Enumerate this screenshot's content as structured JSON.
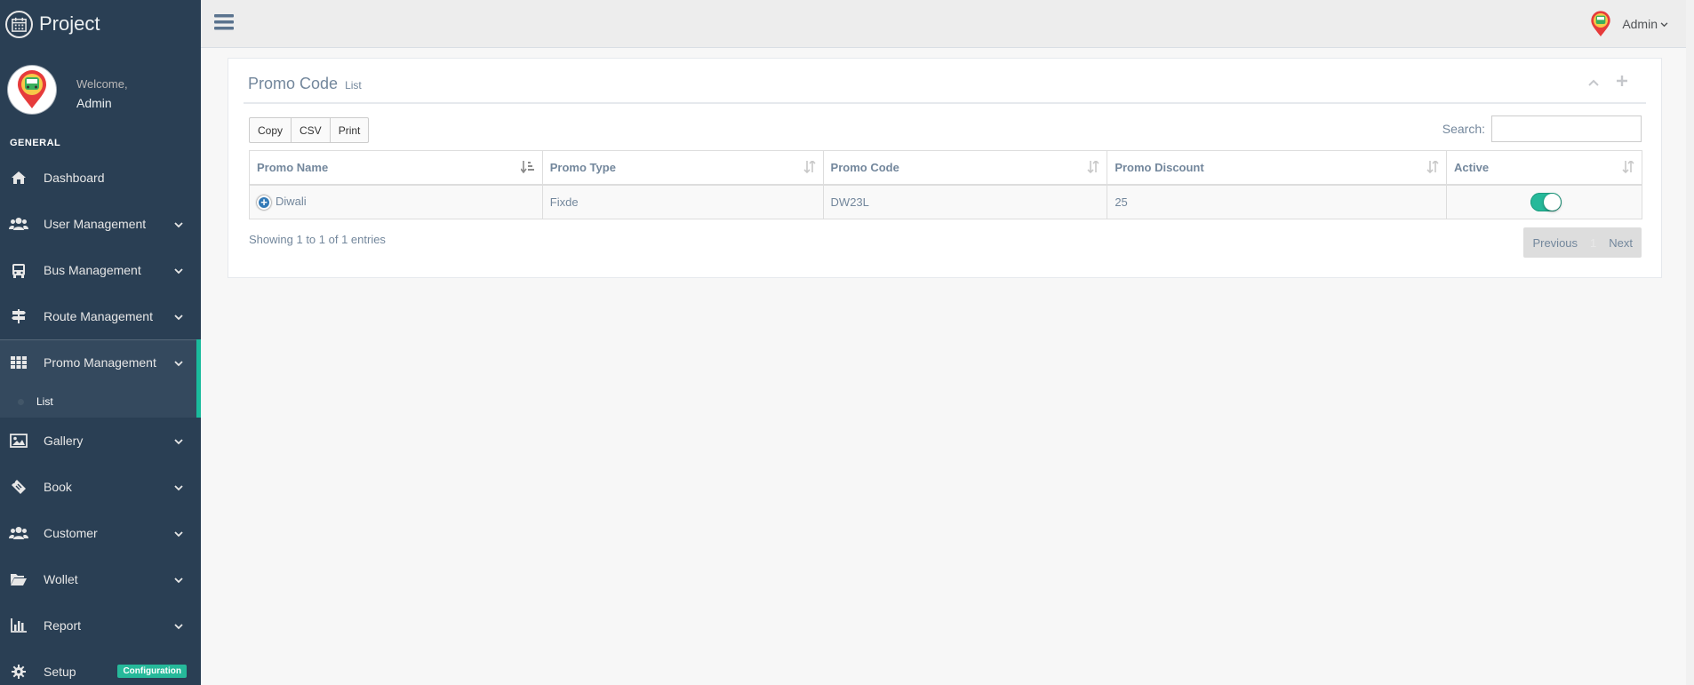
{
  "brand": {
    "title": "Project"
  },
  "profile": {
    "welcome": "Welcome,",
    "name": "Admin"
  },
  "sidebar": {
    "section_title": "GENERAL",
    "items": [
      {
        "label": "Dashboard",
        "icon": "home-icon",
        "has_chevron": false
      },
      {
        "label": "User Management",
        "icon": "users-icon",
        "has_chevron": true
      },
      {
        "label": "Bus Management",
        "icon": "bus-icon",
        "has_chevron": true
      },
      {
        "label": "Route Management",
        "icon": "signpost-icon",
        "has_chevron": true
      },
      {
        "label": "Promo Management",
        "icon": "grid-icon",
        "has_chevron": true,
        "active": true
      },
      {
        "label": "Gallery",
        "icon": "image-icon",
        "has_chevron": true
      },
      {
        "label": "Book",
        "icon": "ticket-icon",
        "has_chevron": true
      },
      {
        "label": "Customer",
        "icon": "users-icon",
        "has_chevron": true
      },
      {
        "label": "Wollet",
        "icon": "folder-icon",
        "has_chevron": true
      },
      {
        "label": "Report",
        "icon": "bar-chart-icon",
        "has_chevron": true
      },
      {
        "label": "Setup",
        "icon": "gear-icon",
        "badge": "Configuration"
      }
    ],
    "submenu": {
      "label": "List"
    }
  },
  "topnav": {
    "user_name": "Admin"
  },
  "panel": {
    "title": "Promo Code",
    "subtitle": "List",
    "buttons": {
      "copy": "Copy",
      "csv": "CSV",
      "print": "Print"
    },
    "search_label": "Search:",
    "search_value": "",
    "columns": [
      "Promo Name",
      "Promo Type",
      "Promo Code",
      "Promo Discount",
      "Active"
    ],
    "rows": [
      {
        "name": "Diwali",
        "type": "Fixde",
        "code": "DW23L",
        "discount": "25",
        "active": true
      }
    ],
    "info": "Showing 1 to 1 of 1 entries",
    "pagination": {
      "previous": "Previous",
      "page": "1",
      "next": "Next"
    }
  },
  "colors": {
    "sidebar_bg": "#2a3f54",
    "accent": "#1abb9c",
    "switch_on": "#26b99a"
  }
}
